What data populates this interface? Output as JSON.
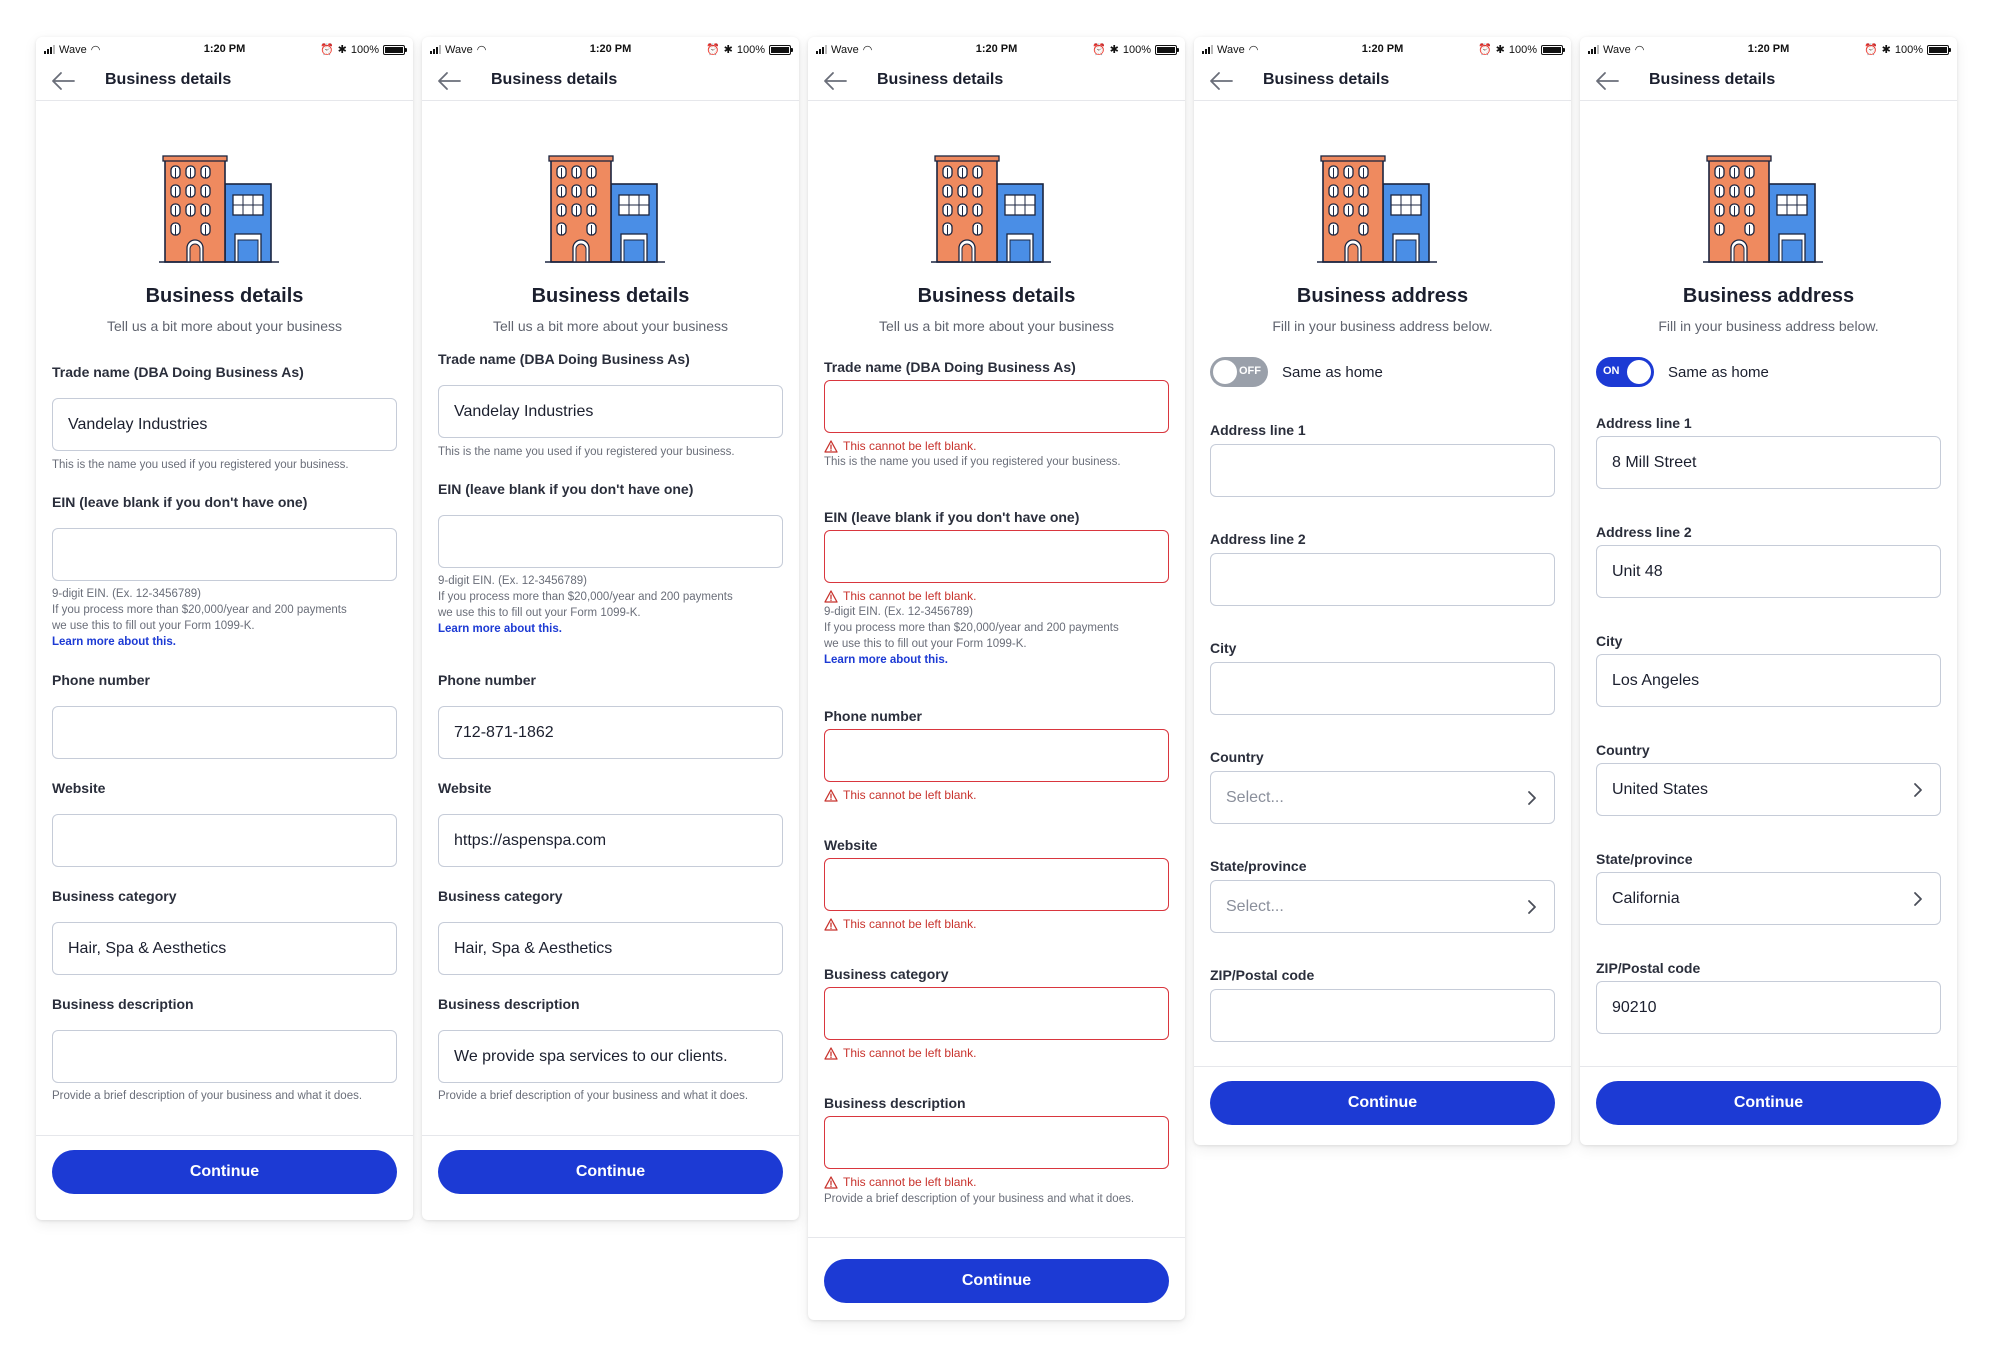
{
  "status": {
    "carrier": "Wave",
    "time": "1:20 PM",
    "battery": "100%"
  },
  "screens": [
    {
      "nav_title": "Business details",
      "heading": "Business details",
      "subheading": "Tell us a bit more about your business",
      "trade_name": {
        "label": "Trade name (DBA Doing Business As)",
        "value": "Vandelay Industries",
        "help": "This is the name you used if you registered your business."
      },
      "ein": {
        "label": "EIN (leave blank if you don't have one)",
        "value": "",
        "help1": "9-digit EIN. (Ex. 12-3456789)",
        "help2": "If you process more than $20,000/year and 200 payments we use this to fill out your Form 1099-K.",
        "link": "Learn more about this."
      },
      "phone": {
        "label": "Phone number",
        "value": ""
      },
      "website": {
        "label": "Website",
        "value": ""
      },
      "category": {
        "label": "Business category",
        "value": "Hair, Spa & Aesthetics"
      },
      "description": {
        "label": "Business description",
        "value": "",
        "help": "Provide a brief description of your business and what it does."
      },
      "button": "Continue"
    },
    {
      "nav_title": "Business details",
      "heading": "Business details",
      "subheading": "Tell us a bit more about your business",
      "trade_name": {
        "label": "Trade name (DBA Doing Business As)",
        "value": "Vandelay Industries",
        "help": "This is the name you used if you registered your business."
      },
      "ein": {
        "label": "EIN (leave blank if you don't have one)",
        "value": "",
        "help1": "9-digit EIN. (Ex. 12-3456789)",
        "help2": "If you process more than $20,000/year and 200 payments we use this to fill out your Form 1099-K.",
        "link": "Learn more about this."
      },
      "phone": {
        "label": "Phone number",
        "value": "712-871-1862"
      },
      "website": {
        "label": "Website",
        "value": "https://aspenspa.com"
      },
      "category": {
        "label": "Business category",
        "value": "Hair, Spa & Aesthetics"
      },
      "description": {
        "label": "Business description",
        "value": "We provide spa services to our clients.",
        "help": "Provide a brief description of your business and what it does."
      },
      "button": "Continue"
    },
    {
      "nav_title": "Business details",
      "heading": "Business details",
      "subheading": "Tell us a bit more about your business",
      "error_text": "This cannot be left blank.",
      "trade_name": {
        "label": "Trade name (DBA Doing Business As)",
        "value": "",
        "help": "This is the name you used if you registered your business."
      },
      "ein": {
        "label": "EIN (leave blank if you don't have one)",
        "value": "",
        "help1": "9-digit EIN. (Ex. 12-3456789)",
        "help2": "If you process more than $20,000/year and 200 payments we use this to fill out your Form 1099-K.",
        "link": "Learn more about this."
      },
      "phone": {
        "label": "Phone number",
        "value": ""
      },
      "website": {
        "label": "Website",
        "value": ""
      },
      "category": {
        "label": "Business category",
        "value": ""
      },
      "description": {
        "label": "Business description",
        "value": "",
        "help": "Provide a brief description of your business and what it does."
      },
      "button": "Continue"
    },
    {
      "nav_title": "Business details",
      "heading": "Business address",
      "subheading": "Fill in your business address below.",
      "toggle": {
        "state": "OFF",
        "label": "Same as home"
      },
      "address1": {
        "label": "Address line 1",
        "value": ""
      },
      "address2": {
        "label": "Address line 2",
        "value": ""
      },
      "city": {
        "label": "City",
        "value": ""
      },
      "country": {
        "label": "Country",
        "value": "",
        "placeholder": "Select..."
      },
      "state": {
        "label": "State/province",
        "value": "",
        "placeholder": "Select..."
      },
      "zip": {
        "label": "ZIP/Postal code",
        "value": ""
      },
      "button": "Continue"
    },
    {
      "nav_title": "Business details",
      "heading": "Business address",
      "subheading": "Fill in your business address below.",
      "toggle": {
        "state": "ON",
        "label": "Same as home"
      },
      "address1": {
        "label": "Address line 1",
        "value": "8 Mill Street"
      },
      "address2": {
        "label": "Address line 2",
        "value": "Unit 48"
      },
      "city": {
        "label": "City",
        "value": "Los Angeles"
      },
      "country": {
        "label": "Country",
        "value": "United States"
      },
      "state": {
        "label": "State/province",
        "value": "California"
      },
      "zip": {
        "label": "ZIP/Postal code",
        "value": "90210"
      },
      "button": "Continue"
    }
  ],
  "colors": {
    "primary": "#1c3ad4",
    "error": "#c8332d",
    "border": "#c6ccd8",
    "building_orange": "#ef8a5f",
    "building_blue": "#4a8ee6"
  }
}
